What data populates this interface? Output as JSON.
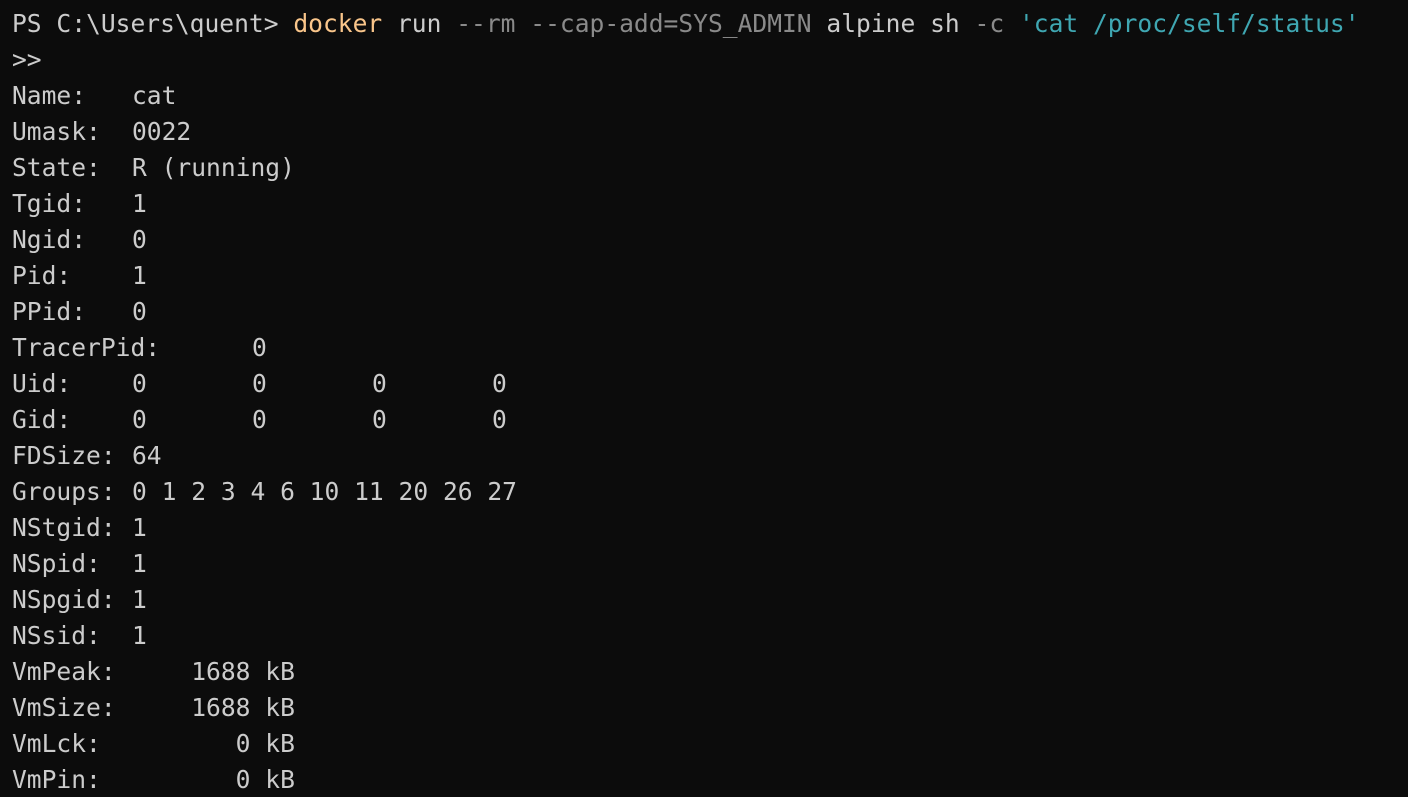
{
  "terminal": {
    "partial_top": "/",
    "prompt": {
      "ps": "PS C:\\Users\\quent>",
      "command": "docker",
      "arg1": "run",
      "flag1": "--rm",
      "flag2": "--cap-add=SYS_ADMIN",
      "arg2": "alpine",
      "arg3": "sh",
      "flag3": "-c",
      "string": "'cat /proc/self/status'"
    },
    "continuation": ">>",
    "status": {
      "name": {
        "key": "Name:",
        "value": "cat"
      },
      "umask": {
        "key": "Umask:",
        "value": "0022"
      },
      "state": {
        "key": "State:",
        "value": "R (running)"
      },
      "tgid": {
        "key": "Tgid:",
        "value": "1"
      },
      "ngid": {
        "key": "Ngid:",
        "value": "0"
      },
      "pid": {
        "key": "Pid:",
        "value": "1"
      },
      "ppid": {
        "key": "PPid:",
        "value": "0"
      },
      "tracerpid": {
        "key": "TracerPid:",
        "value": "0"
      },
      "uid": {
        "key": "Uid:",
        "values": [
          "0",
          "0",
          "0",
          "0"
        ]
      },
      "gid": {
        "key": "Gid:",
        "values": [
          "0",
          "0",
          "0",
          "0"
        ]
      },
      "fdsize": {
        "key": "FDSize:",
        "value": "64"
      },
      "groups": {
        "key": "Groups:",
        "value": "0 1 2 3 4 6 10 11 20 26 27"
      },
      "nstgid": {
        "key": "NStgid:",
        "value": "1"
      },
      "nspid": {
        "key": "NSpid:",
        "value": "1"
      },
      "nspgid": {
        "key": "NSpgid:",
        "value": "1"
      },
      "nssid": {
        "key": "NSsid:",
        "value": "1"
      },
      "vmpeak": {
        "key": "VmPeak:",
        "value": "    1688 kB"
      },
      "vmsize": {
        "key": "VmSize:",
        "value": "    1688 kB"
      },
      "vmlck": {
        "key": "VmLck:",
        "value": "       0 kB"
      },
      "vmpin": {
        "key": "VmPin:",
        "value": "       0 kB"
      }
    }
  }
}
